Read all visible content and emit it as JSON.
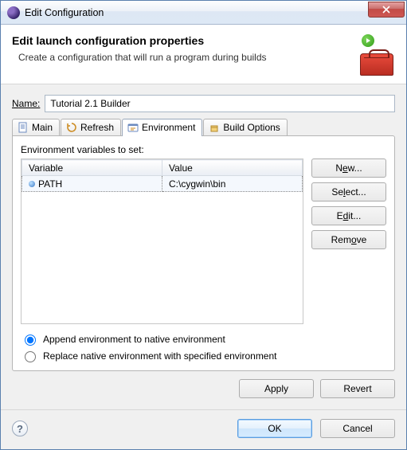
{
  "window": {
    "title": "Edit Configuration"
  },
  "header": {
    "title": "Edit launch configuration properties",
    "description": "Create a configuration that will run a program during builds"
  },
  "name": {
    "label_pre": "N",
    "label_post": "ame:",
    "value": "Tutorial 2.1 Builder"
  },
  "tabs": {
    "main": "Main",
    "refresh": "Refresh",
    "environment": "Environment",
    "build_options": "Build Options",
    "active": "environment"
  },
  "environment": {
    "panel_label": "Environment variables to set:",
    "columns": {
      "variable": "Variable",
      "value": "Value"
    },
    "rows": [
      {
        "variable": "PATH",
        "value": "C:\\cygwin\\bin",
        "selected": true
      }
    ],
    "buttons": {
      "new": "New...",
      "select": "Select...",
      "edit": "Edit...",
      "remove": "Remove"
    },
    "radios": {
      "append": "Append environment to native environment",
      "replace": "Replace native environment with specified environment",
      "selected": "append"
    }
  },
  "actions": {
    "apply": "Apply",
    "revert": "Revert"
  },
  "footer": {
    "ok": "OK",
    "cancel": "Cancel"
  }
}
